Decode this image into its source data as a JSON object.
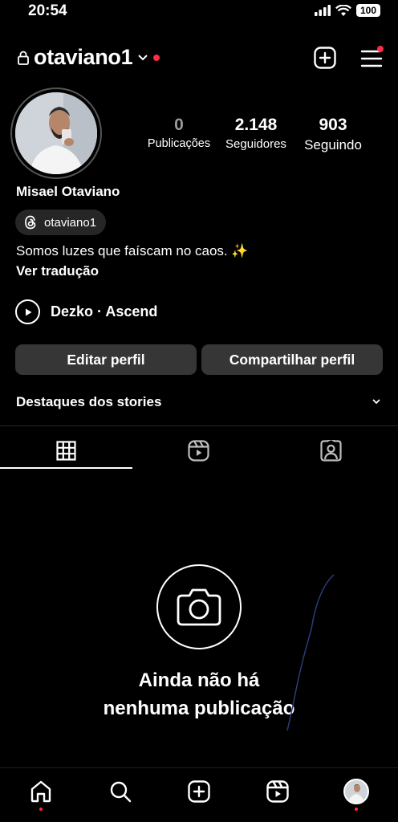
{
  "status_bar": {
    "time": "20:54",
    "battery": "100"
  },
  "header": {
    "username": "otaviano1"
  },
  "profile": {
    "stats": [
      {
        "value": "0",
        "label": "Publicações"
      },
      {
        "value": "2.148",
        "label": "Seguidores"
      },
      {
        "value": "903",
        "label": "Seguindo"
      }
    ],
    "full_name": "Misael Otaviano",
    "threads_handle": "otaviano1",
    "bio": "Somos luzes que faíscam no caos. ✨",
    "translate_label": "Ver tradução",
    "music": "Dezko · Ascend"
  },
  "actions": {
    "edit": "Editar perfil",
    "share": "Compartilhar perfil"
  },
  "highlights": {
    "title": "Destaques dos stories"
  },
  "tabs": [
    "grid-icon",
    "reels-icon",
    "tagged-icon"
  ],
  "empty_state": {
    "title": "Ainda não há\nnenhuma publicação"
  },
  "bottom_nav": [
    "home-icon",
    "search-icon",
    "create-icon",
    "reels-icon",
    "profile-avatar"
  ],
  "colors": {
    "background": "#000000",
    "button": "#363636",
    "notification": "#ff2d45"
  }
}
